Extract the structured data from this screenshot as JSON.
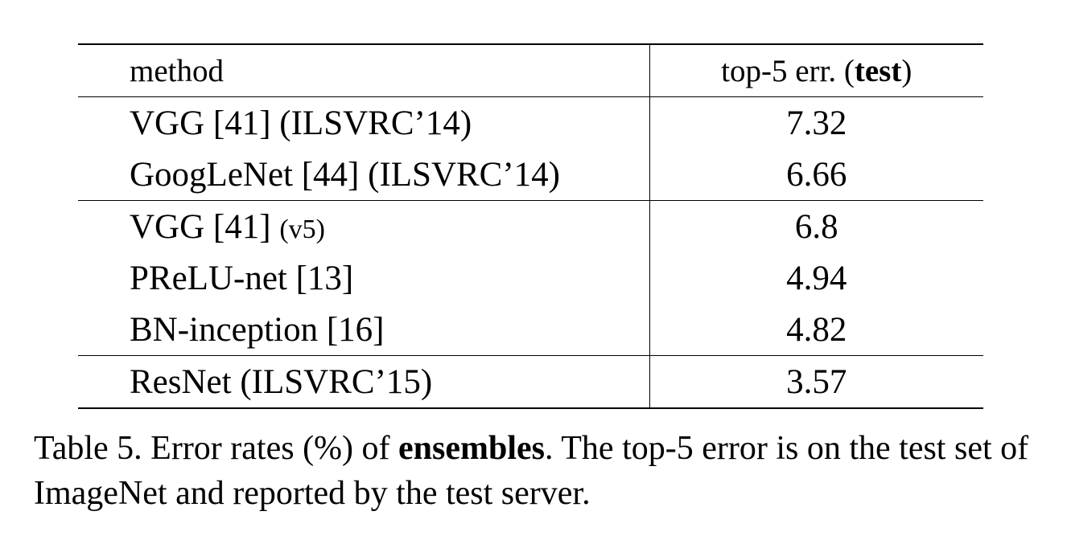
{
  "table": {
    "header": {
      "method": "method",
      "error_prefix": "top-5 err. (",
      "error_bold": "test",
      "error_suffix": ")"
    },
    "groups": [
      {
        "rows": [
          {
            "method": "VGG [41] (ILSVRC’14)",
            "method_note": "",
            "error": "7.32",
            "bold": false
          },
          {
            "method": "GoogLeNet [44] (ILSVRC’14)",
            "method_note": "",
            "error": "6.66",
            "bold": false
          }
        ]
      },
      {
        "rows": [
          {
            "method": "VGG [41] ",
            "method_note": "(v5)",
            "error": "6.8",
            "bold": false
          },
          {
            "method": "PReLU-net [13]",
            "method_note": "",
            "error": "4.94",
            "bold": false
          },
          {
            "method": "BN-inception [16]",
            "method_note": "",
            "error": "4.82",
            "bold": false
          }
        ]
      },
      {
        "rows": [
          {
            "method": "ResNet (ILSVRC’15)",
            "method_note": "",
            "error": "3.57",
            "bold": true
          }
        ]
      }
    ]
  },
  "caption": {
    "label": "Table 5. Error rates (%) of ",
    "bold": "ensembles",
    "rest": ".  The top-5 error is on the test set of ImageNet and reported by the test server."
  }
}
